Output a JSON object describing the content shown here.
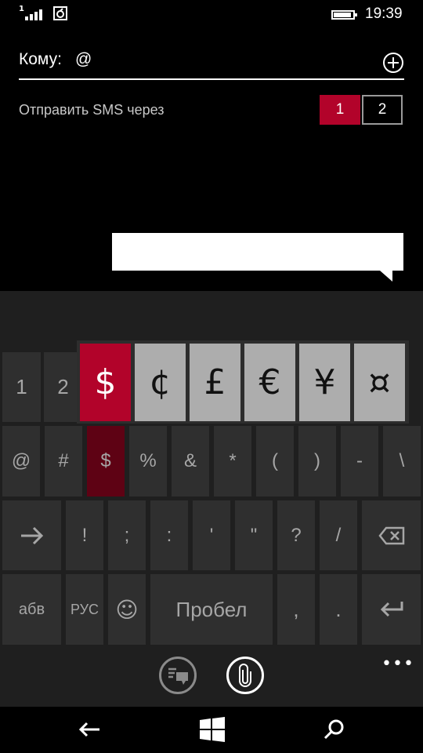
{
  "status_bar": {
    "signal_badge": "1",
    "time": "19:39",
    "icons": [
      "signal-icon",
      "sim-icon",
      "battery-icon"
    ]
  },
  "compose": {
    "to_label": "Кому:",
    "to_value": "@",
    "add_contact_icon": "plus-circle-icon",
    "sms_via_label": "Отправить SMS через",
    "sim_options": [
      "1",
      "2"
    ],
    "selected_sim": "1",
    "message_text": ""
  },
  "keyboard": {
    "row1": [
      "1",
      "2"
    ],
    "popup": [
      "$",
      "¢",
      "£",
      "€",
      "¥",
      "¤"
    ],
    "popup_selected": "$",
    "row2": [
      "@",
      "#",
      "$",
      "%",
      "&",
      "*",
      "(",
      ")",
      "-",
      "\\"
    ],
    "row3": [
      "!",
      ";",
      ":",
      "'",
      "\"",
      "?",
      "/"
    ],
    "row4": {
      "abc": "абв",
      "lang": "РУС",
      "emoji": "☺",
      "space": "Пробел",
      "comma": ",",
      "period": "."
    }
  },
  "app_bar": {
    "buttons": [
      "conversation-icon",
      "attach-icon"
    ],
    "more": "•••"
  },
  "nav_bar": {
    "buttons": [
      "back-icon",
      "windows-icon",
      "search-icon"
    ]
  },
  "colors": {
    "accent": "#b2032a",
    "pressed": "#5e0214",
    "key": "#2f2f2f",
    "keyboard_bg": "#1f1f1f",
    "popup_key": "#adadad"
  }
}
